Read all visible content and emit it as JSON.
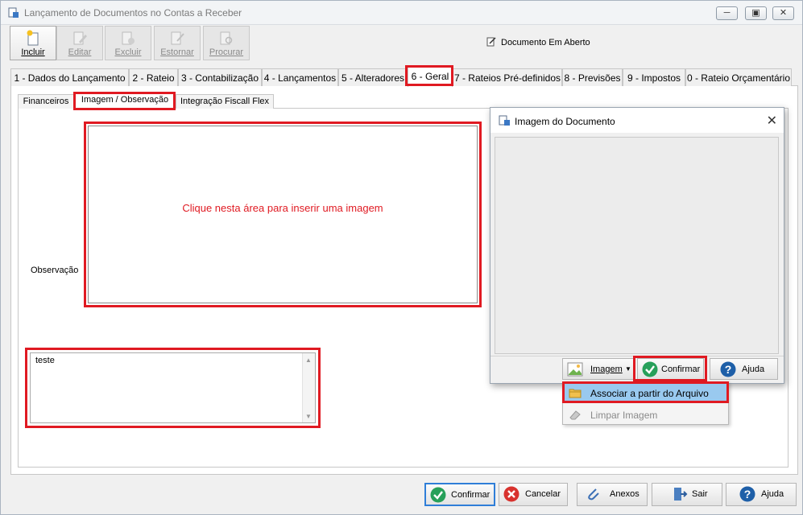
{
  "window": {
    "title": "Lançamento de Documentos no Contas a Receber",
    "controls": [
      "minimize",
      "restore",
      "close"
    ]
  },
  "toolbar": {
    "buttons": [
      {
        "label": "Incluir",
        "icon": "new-document-icon",
        "enabled": true
      },
      {
        "label": "Editar",
        "icon": "edit-icon",
        "enabled": false
      },
      {
        "label": "Excluir",
        "icon": "delete-icon",
        "enabled": false
      },
      {
        "label": "Estornar",
        "icon": "reverse-icon",
        "enabled": false
      },
      {
        "label": "Procurar",
        "icon": "search-icon",
        "enabled": false
      }
    ]
  },
  "document_status": "Documento Em Aberto",
  "tabs": [
    "1 - Dados do Lançamento",
    "2 - Rateio",
    "3 - Contabilização",
    "4 - Lançamentos",
    "5 - Alteradores",
    "6 - Geral",
    "7 - Rateios Pré-definidos",
    "8 - Previsões",
    "9 - Impostos",
    "0 - Rateio Orçamentário"
  ],
  "selected_tab": "6 - Geral",
  "subtabs": [
    "Financeiros",
    "Imagem / Observação",
    "Integração Fiscall Flex"
  ],
  "selected_subtab": "Imagem / Observação",
  "image_area": {
    "hint": "Clique nesta área para inserir uma imagem"
  },
  "observacao": {
    "label": "Observação",
    "value": "teste"
  },
  "dialog": {
    "title": "Imagem do Documento",
    "buttons": {
      "imagem": "Imagem",
      "confirmar": "Confirmar",
      "ajuda": "Ajuda"
    }
  },
  "menu": {
    "items": [
      {
        "label": "Associar a partir do Arquivo",
        "highlighted": true,
        "enabled": true
      },
      {
        "label": "Limpar Imagem",
        "highlighted": false,
        "enabled": false
      }
    ]
  },
  "footer": {
    "confirmar": "Confirmar",
    "cancelar": "Cancelar",
    "anexos": "Anexos",
    "sair": "Sair",
    "ajuda": "Ajuda"
  },
  "colors": {
    "highlight_border": "#e01a22",
    "menu_highlight": "#99c9ef"
  }
}
